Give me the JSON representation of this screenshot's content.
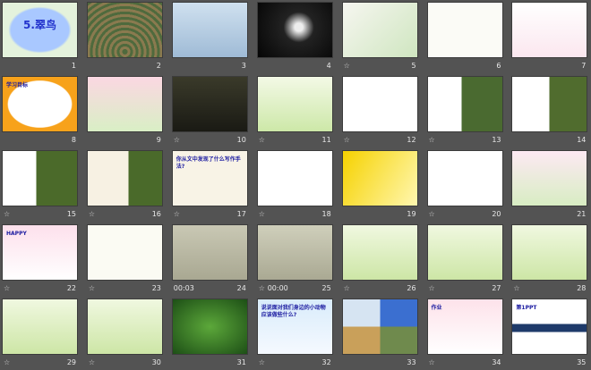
{
  "view": "slide-sorter",
  "star_icon": "☆",
  "slides": [
    {
      "n": "1",
      "star": false,
      "bg": "radial-gradient(#a9c8ff 55%,#e4f2dc 60%)",
      "title": "5.翠鸟",
      "big": true
    },
    {
      "n": "2",
      "star": false,
      "bg": "repeating-radial-gradient(circle at 50% 90%,#4f6a3d 0 3px,#8a7a4f 3px 6px)"
    },
    {
      "n": "3",
      "star": false,
      "bg": "linear-gradient(#cfe0ef,#9fbbd6)"
    },
    {
      "n": "4",
      "star": false,
      "bg": "radial-gradient(circle at 55% 45%,#eee 8%,#222 30%,#050505)"
    },
    {
      "n": "5",
      "star": true,
      "bg": "linear-gradient(135deg,#f6f6f0,#cfe6c0)"
    },
    {
      "n": "6",
      "star": false,
      "bg": "#fbfbf6"
    },
    {
      "n": "7",
      "star": false,
      "bg": "linear-gradient(#fff,#fbe7ef)"
    },
    {
      "n": "8",
      "star": false,
      "bg": "radial-gradient(#fff 60%,#f7a21b 62%)",
      "title": "学习目标"
    },
    {
      "n": "9",
      "star": false,
      "bg": "linear-gradient(#fbd7e2,#d9efc5)"
    },
    {
      "n": "10",
      "star": true,
      "bg": "linear-gradient(#3a3a2a,#1a1a14)"
    },
    {
      "n": "11",
      "star": true,
      "bg": "linear-gradient(#f3f9e6,#cde8a8)"
    },
    {
      "n": "12",
      "star": true,
      "bg": "#ffffff"
    },
    {
      "n": "13",
      "star": true,
      "bg": "linear-gradient(90deg,#fff 45%,#4a6a30 45%)"
    },
    {
      "n": "14",
      "star": false,
      "bg": "linear-gradient(90deg,#fff 50%,#506c2e 50%)"
    },
    {
      "n": "15",
      "star": true,
      "bg": "linear-gradient(90deg,#fff 45%,#4b6a2a 45%)"
    },
    {
      "n": "16",
      "star": true,
      "bg": "linear-gradient(90deg,#f7f1e3 55%,#4a6a2a 55%)"
    },
    {
      "n": "17",
      "star": true,
      "bg": "#f8f3e6",
      "title": "你从文中发现了什么写作手法?"
    },
    {
      "n": "18",
      "star": true,
      "bg": "#ffffff"
    },
    {
      "n": "19",
      "star": false,
      "bg": "linear-gradient(120deg,#f6d200,#fff7b0)"
    },
    {
      "n": "20",
      "star": true,
      "bg": "#ffffff"
    },
    {
      "n": "21",
      "star": false,
      "bg": "linear-gradient(#fde9f3,#d8edc3)"
    },
    {
      "n": "22",
      "star": true,
      "bg": "linear-gradient(#fde0ec,#fff)",
      "title": "HAPPY"
    },
    {
      "n": "23",
      "star": true,
      "bg": "#fbfbf3"
    },
    {
      "n": "24",
      "star": false,
      "time": "00:03",
      "bg": "linear-gradient(#c9c8b4,#a9a892)"
    },
    {
      "n": "25",
      "star": true,
      "time": "00:00",
      "bg": "linear-gradient(#cfcfbb,#aaa993)"
    },
    {
      "n": "26",
      "star": true,
      "bg": "linear-gradient(#f0f8e0,#cde6a6)"
    },
    {
      "n": "27",
      "star": true,
      "bg": "linear-gradient(#f0f8e0,#cde6a6)"
    },
    {
      "n": "28",
      "star": true,
      "bg": "linear-gradient(#f0f8e0,#cde6a6)"
    },
    {
      "n": "29",
      "star": true,
      "bg": "linear-gradient(#f0f8e0,#cde6a6)"
    },
    {
      "n": "30",
      "star": true,
      "bg": "linear-gradient(#f0f8e0,#cde6a6)"
    },
    {
      "n": "31",
      "star": false,
      "bg": "radial-gradient(#5ca83a,#1d4f16)"
    },
    {
      "n": "32",
      "star": true,
      "bg": "linear-gradient(#d9ecfb,#f5f9ff)",
      "title": "说说面对我们身边的小动物应该做些什么?"
    },
    {
      "n": "33",
      "star": false,
      "bg": "conic-gradient(#3b6fd0 0 25%,#6f8a4d 0 50%,#c9a05a 0 75%,#d6e4f2 0)"
    },
    {
      "n": "34",
      "star": true,
      "bg": "linear-gradient(#fde2ea,#fff)",
      "title": "作业"
    },
    {
      "n": "35",
      "star": false,
      "bg": "linear-gradient(#fff 45%,#1e3a6a 45% 60%,#fff 60%)",
      "title": "第1PPT"
    }
  ]
}
